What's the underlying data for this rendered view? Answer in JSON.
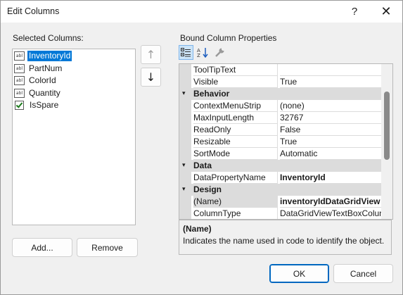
{
  "window": {
    "title": "Edit Columns",
    "help_glyph": "?",
    "close_glyph": "✕"
  },
  "left": {
    "label": "Selected Columns:",
    "columns": [
      {
        "label": "InventoryId",
        "icon": "textbox-column-icon",
        "selected": true
      },
      {
        "label": "PartNum",
        "icon": "textbox-column-icon"
      },
      {
        "label": "ColorId",
        "icon": "textbox-column-icon"
      },
      {
        "label": "Quantity",
        "icon": "textbox-column-icon"
      },
      {
        "label": "IsSpare",
        "icon": "checkbox-column-icon"
      }
    ],
    "icon_text": "abl",
    "move_up": "↑",
    "move_down": "↓",
    "add_label": "Add...",
    "remove_label": "Remove"
  },
  "right": {
    "label": "Bound Column Properties",
    "toolbar": [
      "categorized-icon",
      "alphabetical-icon",
      "property-pages-icon"
    ],
    "rows": {
      "tooltiptext": {
        "name": "ToolTipText",
        "value": ""
      },
      "visible": {
        "name": "Visible",
        "value": "True"
      },
      "cat_behavior": "Behavior",
      "contextmenustrip": {
        "name": "ContextMenuStrip",
        "value": "(none)"
      },
      "maxinputlength": {
        "name": "MaxInputLength",
        "value": "32767"
      },
      "readonly": {
        "name": "ReadOnly",
        "value": "False"
      },
      "resizable": {
        "name": "Resizable",
        "value": "True"
      },
      "sortmode": {
        "name": "SortMode",
        "value": "Automatic"
      },
      "cat_data": "Data",
      "datapropertyname": {
        "name": "DataPropertyName",
        "value": "InventoryId"
      },
      "cat_design": "Design",
      "name": {
        "name": "(Name)",
        "value": "inventoryIdDataGridView"
      },
      "columntype": {
        "name": "ColumnType",
        "value": "DataGridViewTextBoxColun"
      }
    },
    "description": {
      "title": "(Name)",
      "text": "Indicates the name used in code to identify the object."
    }
  },
  "footer": {
    "ok_label": "OK",
    "cancel_label": "Cancel"
  },
  "colors": {
    "accent": "#0078d7",
    "dialog_bg": "#f0f0f0",
    "category_bg": "#dcdcdc"
  }
}
